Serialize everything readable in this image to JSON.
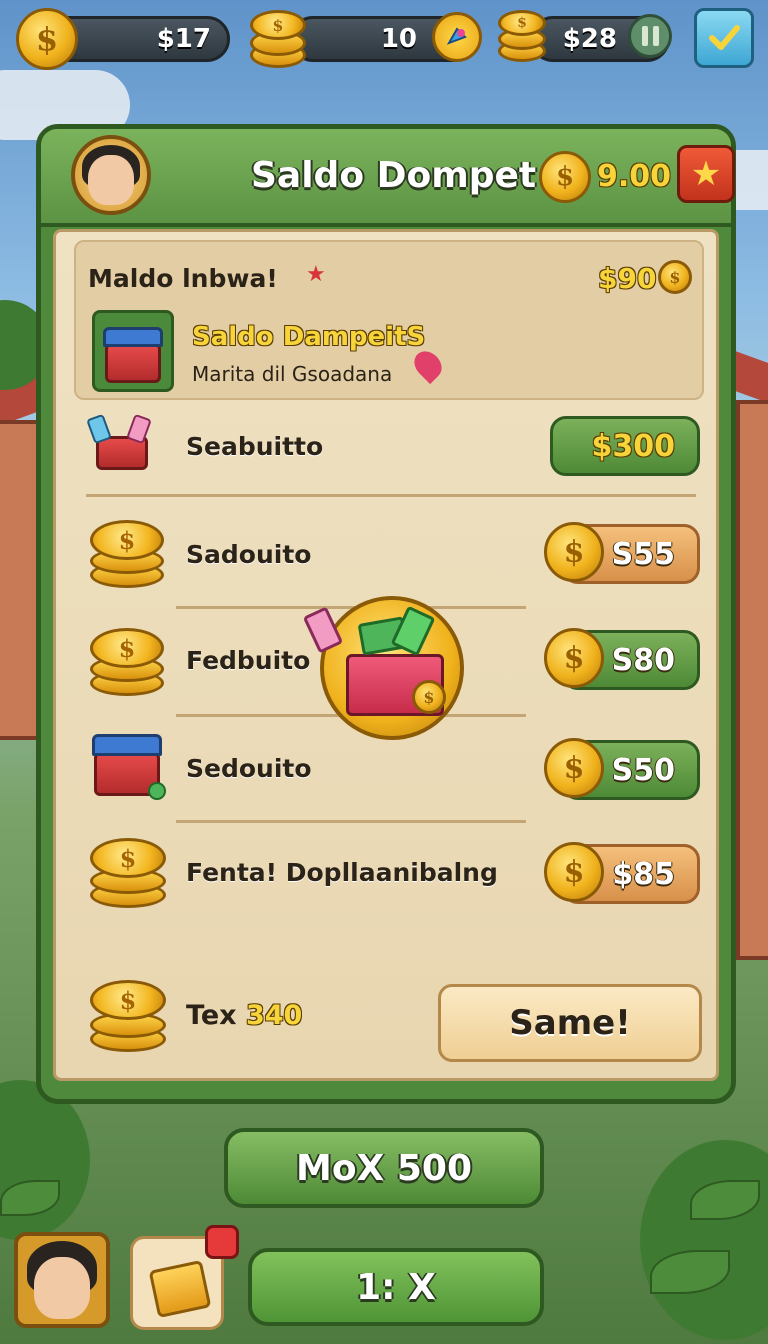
{
  "top_bar": {
    "coins_value": "$17",
    "gems_value": "10",
    "cash_value": "$28",
    "pause_icon": "pause-icon",
    "confirm_icon": "check-icon"
  },
  "panel": {
    "title": "Saldo Dompet",
    "header_value": "9.00",
    "header_button_icon": "star-icon",
    "greeting": "Maldo lnbwa!",
    "greeting_value": "$90",
    "featured_title": "Saldo DampeitS",
    "featured_subtitle": "Marita dil Gsoadana"
  },
  "items": [
    {
      "label": "Seabuitto",
      "price": "$300"
    },
    {
      "label": "Sadouito",
      "price": "S55"
    },
    {
      "label": "Fedbuito",
      "price": "S80"
    },
    {
      "label": "Sedouito",
      "price": "S50"
    },
    {
      "label": "Fenta! Dopllaanibalng",
      "price": "$85"
    }
  ],
  "footer_row": {
    "label_prefix": "Tex",
    "label_value": "340",
    "button": "Same!"
  },
  "bottom": {
    "max_button": "MoX 500",
    "x_button": "1: X"
  },
  "colors": {
    "panel_green": "#4f8a3c",
    "parchment": "#efe2c3",
    "coin_gold": "#f0b21c",
    "price_orange": "#d8904a",
    "accent_yellow": "#f6d43a"
  }
}
